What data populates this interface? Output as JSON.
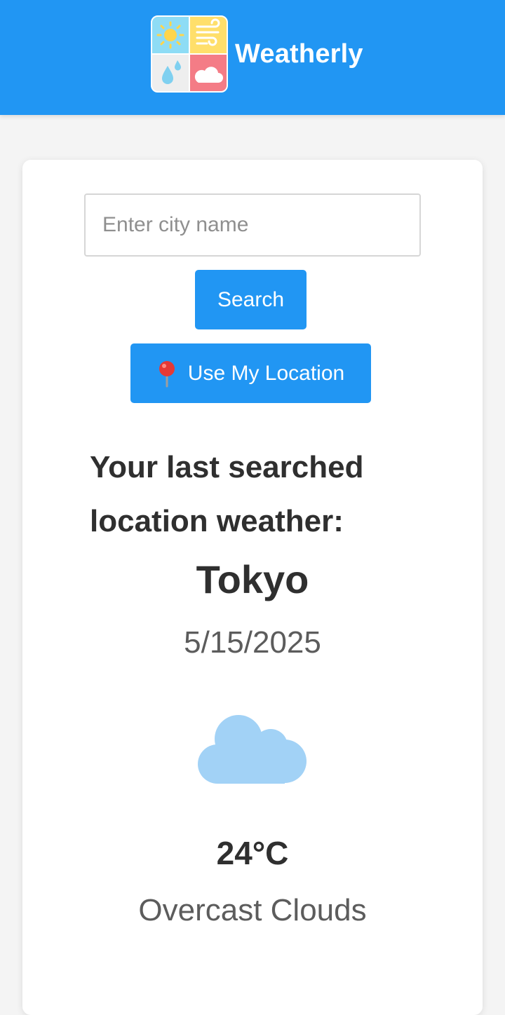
{
  "app": {
    "name": "Weatherly",
    "logo_icon": "weather-tiles-icon"
  },
  "search": {
    "placeholder": "Enter city name",
    "value": "",
    "search_label": "Search",
    "location_label": "Use My Location",
    "location_icon": "map-pin-icon"
  },
  "weather": {
    "heading": "Your last searched location weather:",
    "city": "Tokyo",
    "date": "5/15/2025",
    "icon": "cloud-icon",
    "temperature": "24°C",
    "description": "Overcast Clouds"
  },
  "colors": {
    "primary": "#2196f3",
    "cloud": "#a2d2f6",
    "background": "#f4f4f4",
    "card": "#ffffff"
  }
}
